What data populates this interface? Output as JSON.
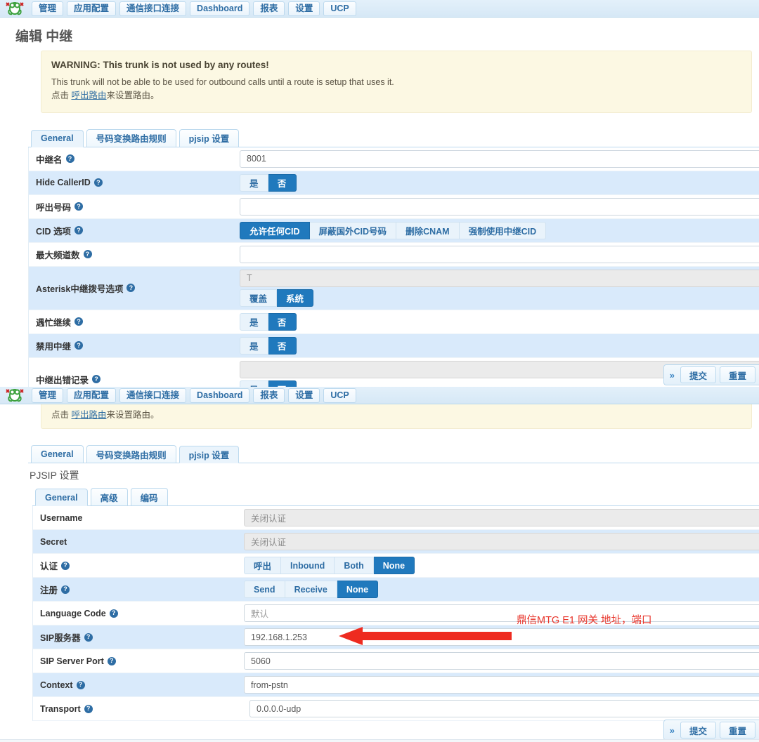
{
  "nav": {
    "logo_icon": "frog-logo-icon",
    "items": [
      {
        "label": "管理"
      },
      {
        "label": "应用配置"
      },
      {
        "label": "通信接口连接"
      },
      {
        "label": "Dashboard"
      },
      {
        "label": "报表"
      },
      {
        "label": "设置"
      },
      {
        "label": "UCP"
      }
    ]
  },
  "top_panel": {
    "page_title": "编辑 中继",
    "warning": {
      "title": "WARNING: This trunk is not used by any routes!",
      "line1": "This trunk will not be able to be used for outbound calls until a route is setup that uses it.",
      "line2_prefix": "点击 ",
      "line2_link": "呼出路由",
      "line2_suffix": "来设置路由。"
    },
    "tabs": [
      {
        "label": "General",
        "active": true
      },
      {
        "label": "号码变换路由规则",
        "active": false
      },
      {
        "label": "pjsip 设置",
        "active": false
      }
    ],
    "rows": [
      {
        "label": "中继名",
        "help": "?",
        "type": "input",
        "value": "8001"
      },
      {
        "label": "Hide CallerID",
        "help": "?",
        "type": "buttons",
        "options": [
          "是",
          "否"
        ],
        "selected": 1
      },
      {
        "label": "呼出号码",
        "help": "?",
        "type": "input",
        "value": ""
      },
      {
        "label": "CID 选项",
        "help": "?",
        "type": "buttons",
        "options": [
          "允许任何CID",
          "屏蔽国外CID号码",
          "删除CNAM",
          "强制使用中继CID"
        ],
        "selected": 0
      },
      {
        "label": "最大频道数",
        "help": "?",
        "type": "input",
        "value": ""
      },
      {
        "label": "Asterisk中继拨号选项",
        "help": "?",
        "type": "input_buttons",
        "value": "T",
        "disabled": true,
        "options": [
          "覆盖",
          "系统"
        ],
        "selected": 1
      },
      {
        "label": "遇忙继续",
        "help": "?",
        "type": "buttons",
        "options": [
          "是",
          "否"
        ],
        "selected": 1
      },
      {
        "label": "禁用中继",
        "help": "?",
        "type": "buttons",
        "options": [
          "是",
          "否"
        ],
        "selected": 1
      },
      {
        "label": "中继出错记录",
        "help": "?",
        "type": "input_buttons",
        "value": "",
        "disabled": true,
        "options": [
          "是",
          "否"
        ],
        "selected": 1
      }
    ],
    "footer": {
      "chevron": "»",
      "submit": "提交",
      "reset": "重置"
    }
  },
  "bottom_panel": {
    "warning": {
      "line2_prefix": "点击 ",
      "line2_link": "呼出路由",
      "line2_suffix": "来设置路由。"
    },
    "tabs": [
      {
        "label": "General",
        "active": false
      },
      {
        "label": "号码变换路由规则",
        "active": false
      },
      {
        "label": "pjsip 设置",
        "active": true
      }
    ],
    "section_title": "PJSIP 设置",
    "subtabs": [
      {
        "label": "General",
        "active": true
      },
      {
        "label": "高级",
        "active": false
      },
      {
        "label": "编码",
        "active": false
      }
    ],
    "rows": [
      {
        "label": "Username",
        "help": "",
        "type": "input",
        "value": "关闭认证",
        "disabled": true
      },
      {
        "label": "Secret",
        "help": "",
        "type": "input",
        "value": "关闭认证",
        "disabled": true
      },
      {
        "label": "认证",
        "help": "?",
        "type": "buttons",
        "options": [
          "呼出",
          "Inbound",
          "Both",
          "None"
        ],
        "selected": 3
      },
      {
        "label": "注册",
        "help": "?",
        "type": "buttons",
        "options": [
          "Send",
          "Receive",
          "None"
        ],
        "selected": 2
      },
      {
        "label": "Language Code",
        "help": "?",
        "type": "input",
        "value": "默认"
      },
      {
        "label": "SIP服务器",
        "help": "?",
        "type": "input",
        "value": "192.168.1.253"
      },
      {
        "label": "SIP Server Port",
        "help": "?",
        "type": "input",
        "value": "5060"
      },
      {
        "label": "Context",
        "help": "?",
        "type": "input",
        "value": "from-pstn"
      },
      {
        "label": "Transport",
        "help": "?",
        "type": "input",
        "value": "0.0.0.0-udp"
      }
    ],
    "annotation": {
      "text": "鼎信MTG E1 网关 地址，端口",
      "color": "#e8342a",
      "arrow_icon": "left-arrow-annotation-icon"
    },
    "footer": {
      "chevron": "»",
      "submit": "提交",
      "reset": "重置"
    }
  }
}
